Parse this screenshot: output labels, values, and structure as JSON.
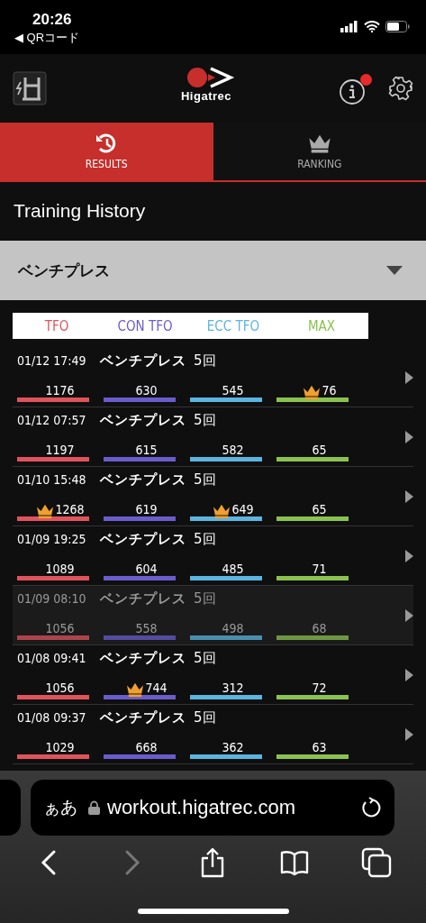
{
  "status_bar": {
    "time": "20:26",
    "back_link": "◀ QRコード"
  },
  "header": {
    "logo_text": "Higatrec",
    "notification": true
  },
  "tabs": [
    {
      "label": "RESULTS",
      "kind": "history",
      "selected": true
    },
    {
      "label": "RANKING",
      "kind": "crown",
      "selected": false
    }
  ],
  "title": "Training History",
  "exercise_select": {
    "value": "ベンチプレス"
  },
  "legend": [
    {
      "label": "TFO",
      "color": "#e0535c"
    },
    {
      "label": "CON TFO",
      "color": "#6a5ccc"
    },
    {
      "label": "ECC TFO",
      "color": "#5ab5e0"
    },
    {
      "label": "MAX",
      "color": "#8bc24f"
    }
  ],
  "rows": [
    {
      "datetime": "01/12 17:49",
      "exercise": "ベンチプレス",
      "reps": "5回",
      "selected": false,
      "metrics": [
        {
          "value": "1176",
          "best": false
        },
        {
          "value": "630",
          "best": false
        },
        {
          "value": "545",
          "best": false
        },
        {
          "value": "76",
          "best": true
        }
      ]
    },
    {
      "datetime": "01/12 07:57",
      "exercise": "ベンチプレス",
      "reps": "5回",
      "selected": false,
      "metrics": [
        {
          "value": "1197",
          "best": false
        },
        {
          "value": "615",
          "best": false
        },
        {
          "value": "582",
          "best": false
        },
        {
          "value": "65",
          "best": false
        }
      ]
    },
    {
      "datetime": "01/10 15:48",
      "exercise": "ベンチプレス",
      "reps": "5回",
      "selected": false,
      "metrics": [
        {
          "value": "1268",
          "best": true
        },
        {
          "value": "619",
          "best": false
        },
        {
          "value": "649",
          "best": true
        },
        {
          "value": "65",
          "best": false
        }
      ]
    },
    {
      "datetime": "01/09 19:25",
      "exercise": "ベンチプレス",
      "reps": "5回",
      "selected": false,
      "metrics": [
        {
          "value": "1089",
          "best": false
        },
        {
          "value": "604",
          "best": false
        },
        {
          "value": "485",
          "best": false
        },
        {
          "value": "71",
          "best": false
        }
      ]
    },
    {
      "datetime": "01/09 08:10",
      "exercise": "ベンチプレス",
      "reps": "5回",
      "selected": true,
      "metrics": [
        {
          "value": "1056",
          "best": false
        },
        {
          "value": "558",
          "best": false
        },
        {
          "value": "498",
          "best": false
        },
        {
          "value": "68",
          "best": false
        }
      ]
    },
    {
      "datetime": "01/08 09:41",
      "exercise": "ベンチプレス",
      "reps": "5回",
      "selected": false,
      "metrics": [
        {
          "value": "1056",
          "best": false
        },
        {
          "value": "744",
          "best": true
        },
        {
          "value": "312",
          "best": false
        },
        {
          "value": "72",
          "best": false
        }
      ]
    },
    {
      "datetime": "01/08 09:37",
      "exercise": "ベンチプレス",
      "reps": "5回",
      "selected": false,
      "metrics": [
        {
          "value": "1029",
          "best": false
        },
        {
          "value": "668",
          "best": false
        },
        {
          "value": "362",
          "best": false
        },
        {
          "value": "63",
          "best": false
        }
      ]
    }
  ],
  "browser": {
    "text_size_button": "ぁあ",
    "url": "workout.higatrec.com"
  }
}
